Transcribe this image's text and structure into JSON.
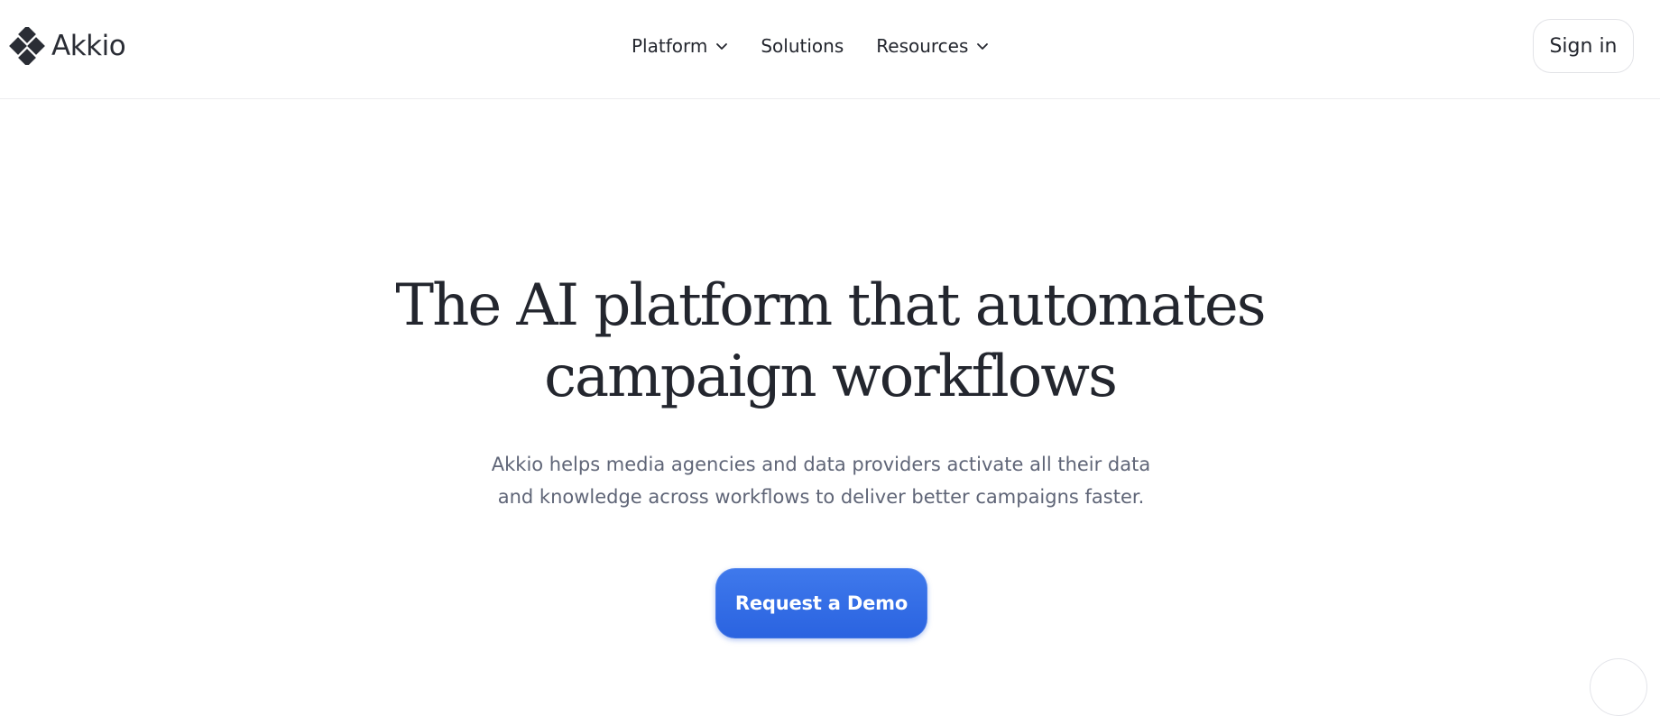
{
  "header": {
    "logo_text": "Akkio",
    "logo_icon": "akkio-diamond-logo",
    "nav": [
      {
        "label": "Platform",
        "has_dropdown": true
      },
      {
        "label": "Solutions",
        "has_dropdown": false
      },
      {
        "label": "Resources",
        "has_dropdown": true
      }
    ],
    "signin_label": "Sign in"
  },
  "hero": {
    "title_line1": "The AI platform that automates",
    "title_line2": "campaign workflows",
    "subtitle_line1": "Akkio helps media agencies and data providers activate all their data",
    "subtitle_line2": "and knowledge across workflows to deliver better campaigns faster.",
    "cta_label": "Request a Demo"
  },
  "colors": {
    "text": "#23262e",
    "muted": "#5f6577",
    "accent": "#2f68e4"
  }
}
